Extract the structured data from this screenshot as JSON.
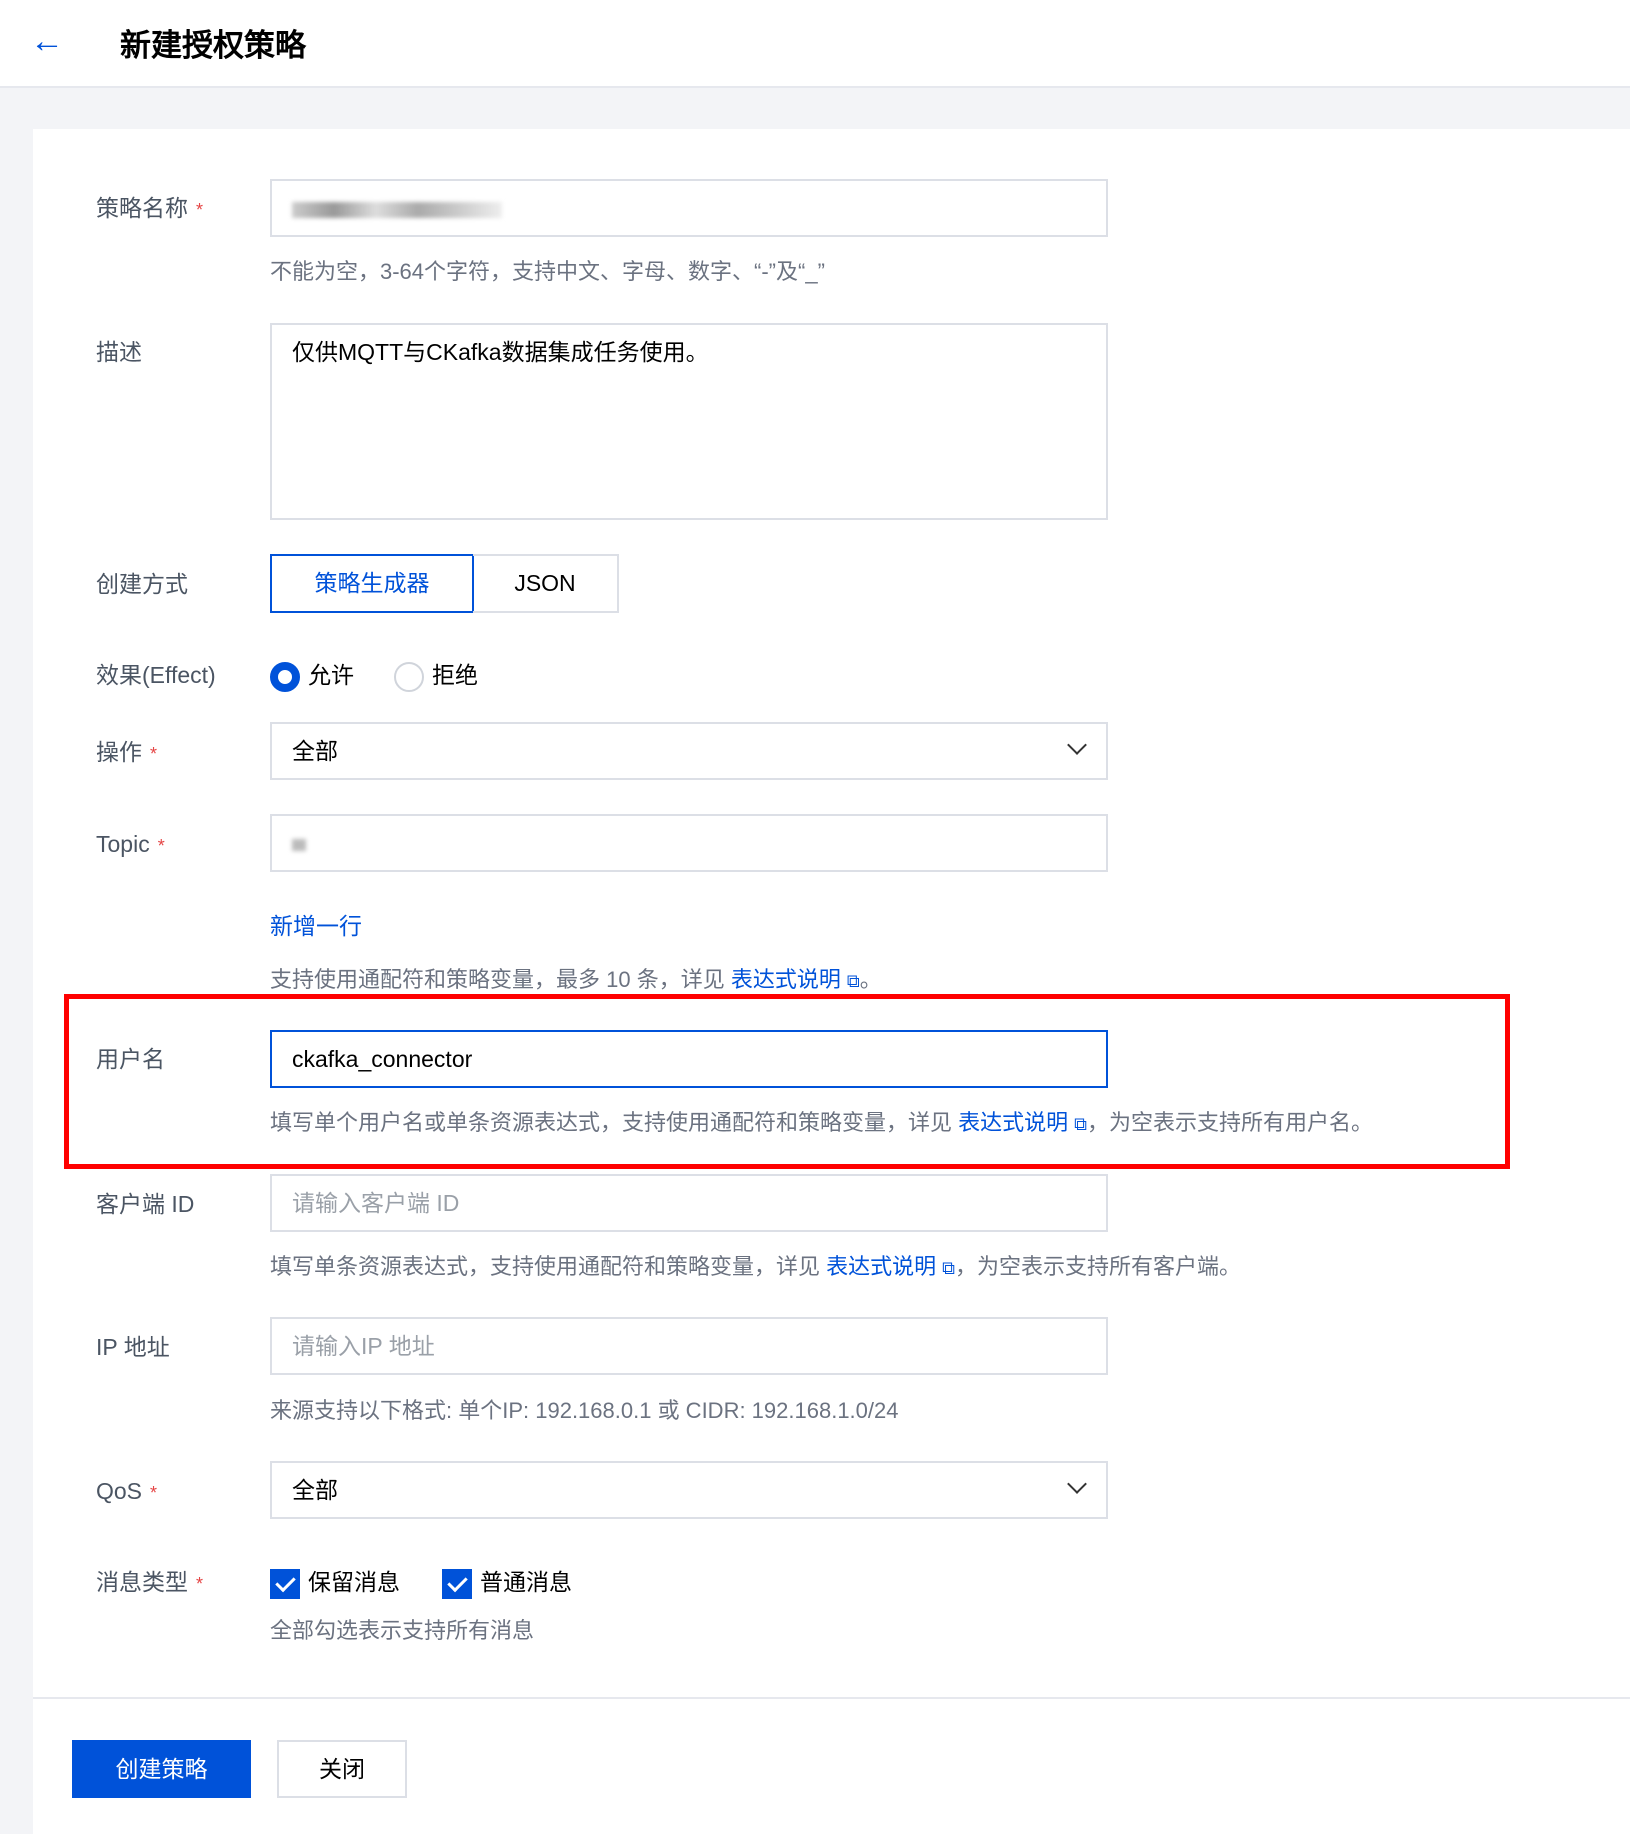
{
  "header": {
    "back_icon": "arrow-left-icon",
    "title": "新建授权策略"
  },
  "form": {
    "name": {
      "label": "策略名称",
      "required": "*",
      "value": "(redacted)",
      "hint": "不能为空，3-64个字符，支持中文、字母、数字、“-”及“_”"
    },
    "description": {
      "label": "描述",
      "value": "仅供MQTT与CKafka数据集成任务使用。"
    },
    "method": {
      "label": "创建方式",
      "options": [
        "策略生成器",
        "JSON"
      ],
      "selected": "策略生成器"
    },
    "effect": {
      "label": "效果(Effect)",
      "options": [
        "允许",
        "拒绝"
      ],
      "selected": "允许"
    },
    "action": {
      "label": "操作",
      "required": "*",
      "value": "全部"
    },
    "topic": {
      "label": "Topic",
      "required": "*",
      "value": "(redacted)",
      "add_row": "新增一行",
      "hint_prefix": "支持使用通配符和策略变量，最多 10 条，详见 ",
      "hint_link": "表达式说明",
      "hint_suffix": "。"
    },
    "username": {
      "label": "用户名",
      "value": "ckafka_connector",
      "hint_prefix": "填写单个用户名或单条资源表达式，支持使用通配符和策略变量，详见 ",
      "hint_link": "表达式说明",
      "hint_suffix": "，为空表示支持所有用户名。",
      "highlight_color": "#ff0000"
    },
    "client_id": {
      "label": "客户端 ID",
      "placeholder": "请输入客户端 ID",
      "hint_prefix": "填写单条资源表达式，支持使用通配符和策略变量，详见 ",
      "hint_link": "表达式说明",
      "hint_suffix": "，为空表示支持所有客户端。"
    },
    "ip": {
      "label": "IP 地址",
      "placeholder": "请输入IP 地址",
      "hint": "来源支持以下格式: 单个IP: 192.168.0.1 或 CIDR: 192.168.1.0/24"
    },
    "qos": {
      "label": "QoS",
      "required": "*",
      "value": "全部"
    },
    "message_type": {
      "label": "消息类型",
      "required": "*",
      "options": [
        {
          "label": "保留消息",
          "checked": true
        },
        {
          "label": "普通消息",
          "checked": true
        }
      ],
      "hint": "全部勾选表示支持所有消息"
    }
  },
  "footer": {
    "create": "创建策略",
    "close": "关闭"
  },
  "colors": {
    "accent": "#0052d9",
    "required": "#e54545"
  }
}
